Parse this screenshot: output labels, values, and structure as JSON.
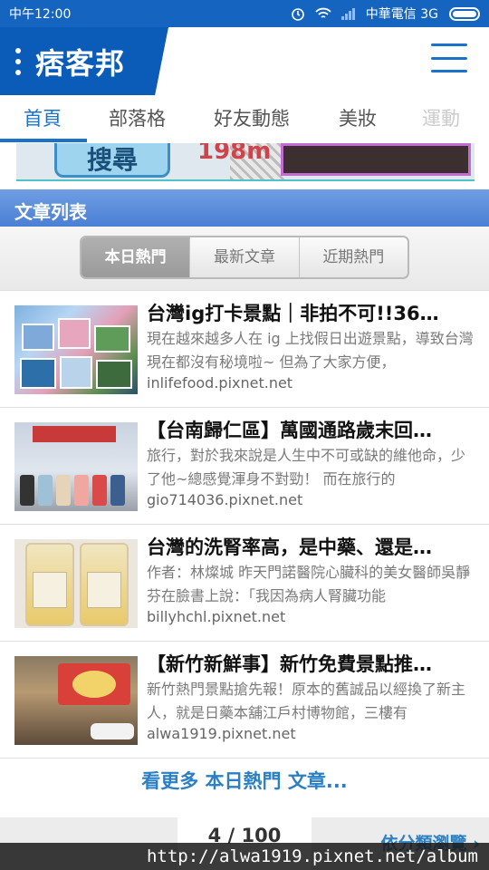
{
  "status_bar": {
    "time": "中午12:00",
    "carrier": "中華電信 3G",
    "icons": [
      "alarm-icon",
      "wifi-icon",
      "signal-icon",
      "battery-icon"
    ]
  },
  "header": {
    "logo_text": "痞客邦",
    "brand_color": "#0a5cb8",
    "menu_icon": "hamburger-menu-icon"
  },
  "tabs": [
    {
      "label": "首頁",
      "active": true
    },
    {
      "label": "部落格",
      "active": false
    },
    {
      "label": "好友動態",
      "active": false
    },
    {
      "label": "美妝",
      "active": false
    },
    {
      "label": "運動",
      "active": false
    }
  ],
  "banner": {
    "button_text": "搜尋",
    "price_text": "198m"
  },
  "section": {
    "title": "文章列表"
  },
  "segments": [
    {
      "label": "本日熱門",
      "active": true
    },
    {
      "label": "最新文章",
      "active": false
    },
    {
      "label": "近期熱門",
      "active": false
    }
  ],
  "articles": [
    {
      "title": "台灣ig打卡景點｜非拍不可!!36…",
      "excerpt": "現在越來越多人在 ig 上找假日出遊景點，導致台灣現在都沒有秘境啦~ 但為了大家方便，",
      "source": "inlifefood.pixnet.net"
    },
    {
      "title": "【台南歸仁區】萬國通路歲末回…",
      "excerpt": "旅行，對於我來說是人生中不可或缺的維他命，少了他~總感覺渾身不對勁！ 而在旅行的",
      "source": "gio714036.pixnet.net"
    },
    {
      "title": "台灣的洗腎率高，是中藥、還是…",
      "excerpt": "作者：林燦城 昨天門諾醫院心臟科的美女醫師吳靜芬在臉書上說：「我因為病人腎臟功能",
      "source": "billyhchl.pixnet.net"
    },
    {
      "title": "【新竹新鮮事】新竹免費景點推…",
      "excerpt": "新竹熱門景點搶先報！原本的舊誠品以經換了新主人，就是日藥本舖江戶村博物館，三樓有",
      "source": "alwa1919.pixnet.net"
    }
  ],
  "more_link": "看更多 本日熱門 文章...",
  "pager": {
    "page_text": "4 / 100",
    "browse_text": "依分類瀏覽 ›"
  },
  "watermark": "http://alwa1919.pixnet.net/album"
}
